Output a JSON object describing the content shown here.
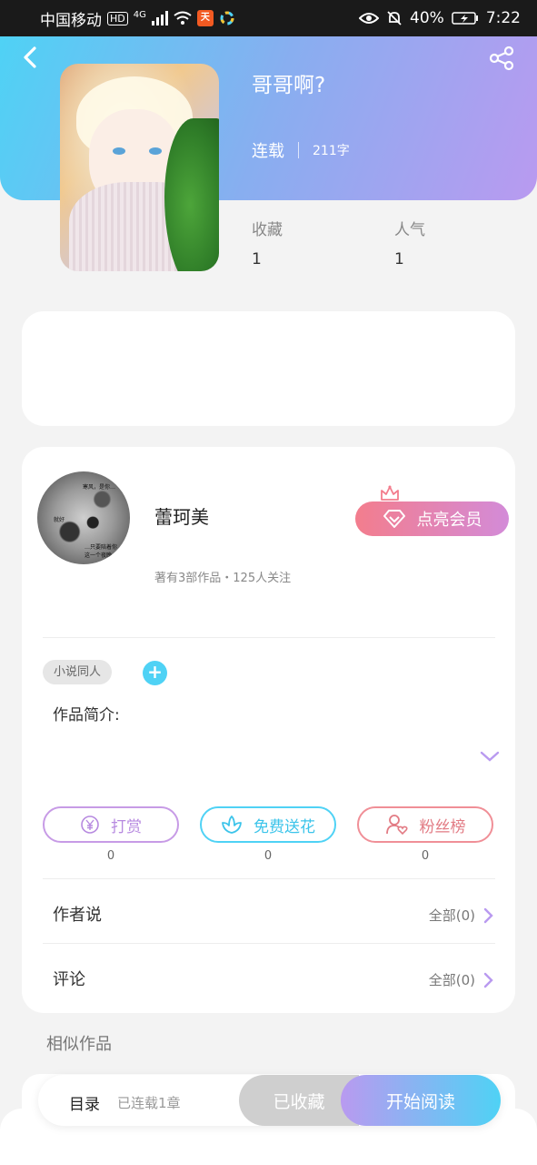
{
  "status_bar": {
    "carrier": "中国移动",
    "hd": "HD",
    "network": "4G",
    "battery": "40%",
    "time": "7:22",
    "app_icon_label": "天"
  },
  "book": {
    "title": "哥哥啊?",
    "status": "连载",
    "word_count": "211字",
    "stats": [
      {
        "label": "收藏",
        "value": "1"
      },
      {
        "label": "人气",
        "value": "1"
      }
    ]
  },
  "author": {
    "name": "蕾珂美",
    "meta": "著有3部作品・125人关注",
    "avatar_lines": [
      "寒风，是你…",
      "就好",
      "…只要陪着你",
      "这一个夜晚"
    ]
  },
  "vip_button": {
    "label": "点亮会员"
  },
  "tags": [
    {
      "label": "小说同人"
    }
  ],
  "add_tag": {
    "label": "+"
  },
  "intro": {
    "label": "作品简介:"
  },
  "actions": [
    {
      "label": "打赏",
      "count": "0"
    },
    {
      "label": "免费送花",
      "count": "0"
    },
    {
      "label": "粉丝榜",
      "count": "0"
    }
  ],
  "rows": [
    {
      "label": "作者说",
      "link": "全部(0)"
    },
    {
      "label": "评论",
      "link": "全部(0)"
    }
  ],
  "similar": {
    "label": "相似作品"
  },
  "bottom_bar": {
    "toc": "目录",
    "chapters": "已连载1章",
    "favorited": "已收藏",
    "start_reading": "开始阅读"
  },
  "colors": {
    "accent_cyan": "#4fd2f5",
    "accent_purple": "#b99af0",
    "vip_pink": "#f37d8d",
    "fans_red": "#f08f97"
  }
}
